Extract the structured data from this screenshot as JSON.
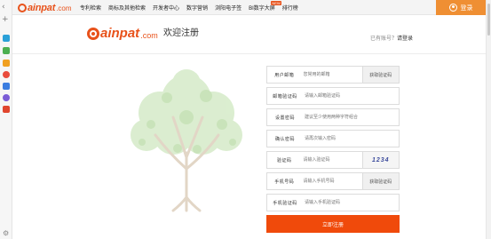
{
  "brand": {
    "name": "ainpat",
    "domain": ".com"
  },
  "nav": {
    "items": [
      "专利检索",
      "商标及其他检索",
      "开发者中心",
      "数字营销",
      "浏阳电子签",
      "BI数字大屏",
      "排行榜"
    ],
    "hot_badge": "NEW",
    "login_label": "登录"
  },
  "header": {
    "brand_name": "ainpat",
    "brand_domain": ".com",
    "title": "欢迎注册",
    "have_account": "已有账号？",
    "login_link": "请登录"
  },
  "form": {
    "email_label": "用户邮箱",
    "email_placeholder": "您常用的邮箱",
    "email_btn": "获取验证码",
    "email_code_label": "邮箱验证码",
    "email_code_placeholder": "请输入邮箱验证码",
    "password_label": "设置密码",
    "password_placeholder": "建议至少使用两种字符组合",
    "confirm_label": "确认密码",
    "confirm_placeholder": "请再次输入密码",
    "captcha_label": "验证码",
    "captcha_placeholder": "请输入验证码",
    "captcha_text": "1234",
    "phone_label": "手机号码",
    "phone_placeholder": "请输入手机号码",
    "phone_btn": "获取验证码",
    "sms_label": "手机验证码",
    "sms_placeholder": "请输入手机验证码",
    "submit_label": "立即注册"
  },
  "colors": {
    "brand_orange": "#e8521b",
    "login_bg": "#ef8f33",
    "submit_bg": "#f04a0b",
    "tree_green": "#cfe6c2"
  }
}
